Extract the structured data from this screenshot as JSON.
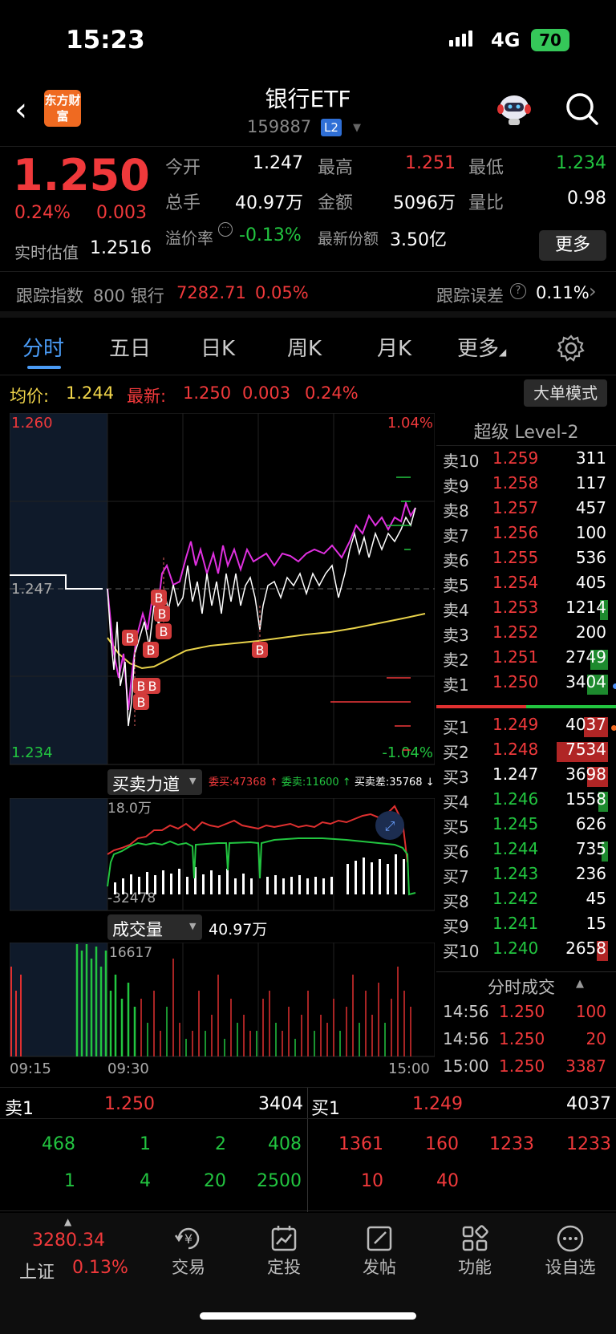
{
  "status_bar": {
    "time": "15:23",
    "network": "4G",
    "battery": "70"
  },
  "nav": {
    "logo": "东方财富",
    "title": "银行ETF",
    "code": "159887",
    "level_badge": "L2"
  },
  "quote": {
    "price": "1.250",
    "change_pct": "0.24%",
    "change": "0.003",
    "open_label": "今开",
    "open": "1.247",
    "high_label": "最高",
    "high": "1.251",
    "low_label": "最低",
    "low": "1.234",
    "volume_label": "总手",
    "volume": "40.97万",
    "amount_label": "金额",
    "amount": "5096万",
    "ratio_label": "量比",
    "ratio": "0.98",
    "iopv_label": "实时估值",
    "iopv": "1.2516",
    "premium_label": "溢价率",
    "premium": "-0.13%",
    "shares_label": "最新份额",
    "shares": "3.50亿",
    "more_btn": "更多"
  },
  "tracking": {
    "label": "跟踪指数",
    "index_name": "800 银行",
    "index_value": "7282.71",
    "index_pct": "0.05%",
    "error_label": "跟踪误差",
    "error": "0.11%"
  },
  "tabs": [
    "分时",
    "五日",
    "日K",
    "周K",
    "月K",
    "更多"
  ],
  "avg_line": {
    "avg_label": "均价:",
    "avg": "1.244",
    "last_label": "最新:",
    "last": "1.250",
    "change": "0.003",
    "pct": "0.24%"
  },
  "big_order_btn": "大单模式",
  "chart": {
    "price_top": "1.260",
    "price_mid": "1.247",
    "price_bottom": "1.234",
    "pct_top": "1.04%",
    "pct_bottom": "-1.04%",
    "b_markers": [
      "B",
      "B",
      "B",
      "B",
      "B",
      "B",
      "B",
      "B",
      "B"
    ],
    "force_label": "买卖力道",
    "bid_label": "委买:47368",
    "ask_label": "委卖:11600",
    "diff_label": "买卖差:35768",
    "force_top": "18.0万",
    "force_bottom": "-32478",
    "vol_label": "成交量",
    "vol_total": "40.97万",
    "vol_top": "16617",
    "time_start": "09:15",
    "time_mid": "09:30",
    "time_end": "15:00"
  },
  "level2": {
    "title": "超级 Level-2",
    "asks": [
      {
        "label": "卖10",
        "price": "1.259",
        "vol": "311"
      },
      {
        "label": "卖9",
        "price": "1.258",
        "vol": "117"
      },
      {
        "label": "卖8",
        "price": "1.257",
        "vol": "457"
      },
      {
        "label": "卖7",
        "price": "1.256",
        "vol": "100"
      },
      {
        "label": "卖6",
        "price": "1.255",
        "vol": "536"
      },
      {
        "label": "卖5",
        "price": "1.254",
        "vol": "405"
      },
      {
        "label": "卖4",
        "price": "1.253",
        "vol": "1214"
      },
      {
        "label": "卖3",
        "price": "1.252",
        "vol": "200"
      },
      {
        "label": "卖2",
        "price": "1.251",
        "vol": "2749"
      },
      {
        "label": "卖1",
        "price": "1.250",
        "vol": "3404"
      }
    ],
    "bids": [
      {
        "label": "买1",
        "price": "1.249",
        "vol": "4037"
      },
      {
        "label": "买2",
        "price": "1.248",
        "vol": "7534"
      },
      {
        "label": "买3",
        "price": "1.247",
        "vol": "3698"
      },
      {
        "label": "买4",
        "price": "1.246",
        "vol": "1558"
      },
      {
        "label": "买5",
        "price": "1.245",
        "vol": "626"
      },
      {
        "label": "买6",
        "price": "1.244",
        "vol": "735"
      },
      {
        "label": "买7",
        "price": "1.243",
        "vol": "236"
      },
      {
        "label": "买8",
        "price": "1.242",
        "vol": "45"
      },
      {
        "label": "买9",
        "price": "1.241",
        "vol": "15"
      },
      {
        "label": "买10",
        "price": "1.240",
        "vol": "2658"
      }
    ],
    "ticks_title": "分时成交",
    "ticks": [
      {
        "time": "14:56",
        "price": "1.250",
        "vol": "100"
      },
      {
        "time": "14:56",
        "price": "1.250",
        "vol": "20"
      },
      {
        "time": "15:00",
        "price": "1.250",
        "vol": "3387"
      }
    ]
  },
  "summary": {
    "ask_label": "卖1",
    "ask_price": "1.250",
    "ask_vol": "3404",
    "bid_label": "买1",
    "bid_price": "1.249",
    "bid_vol": "4037",
    "ask_orders": [
      "468",
      "1",
      "2",
      "408",
      "1",
      "4",
      "20",
      "2500"
    ],
    "bid_orders": [
      "1361",
      "160",
      "1233",
      "1233",
      "10",
      "40"
    ]
  },
  "bottom_nav": {
    "index_value": "3280.34",
    "index_name": "上证",
    "index_pct": "0.13%",
    "items": [
      "交易",
      "定投",
      "发帖",
      "功能",
      "设自选"
    ]
  }
}
